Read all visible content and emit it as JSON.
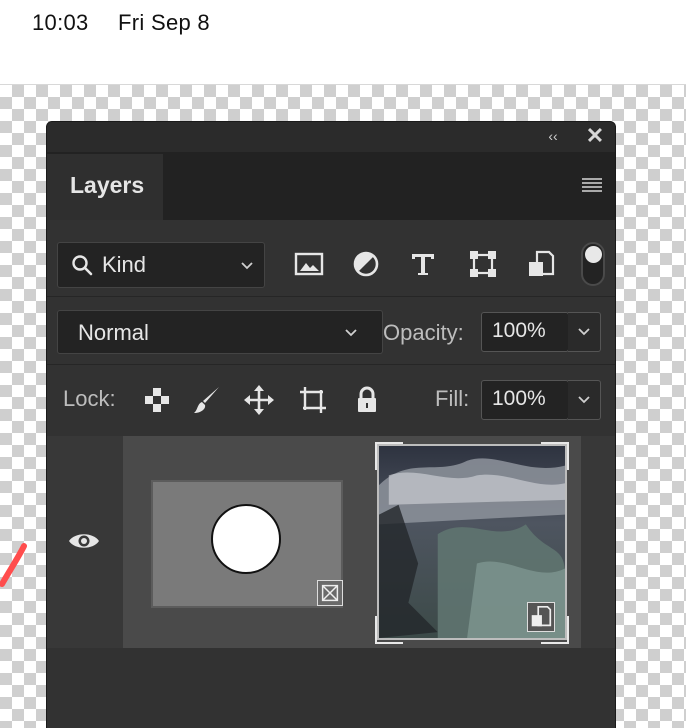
{
  "status_bar": {
    "time": "10:03",
    "date": "Fri Sep 8"
  },
  "panel": {
    "tab_title": "Layers",
    "filter": {
      "kind_label": "Kind",
      "icons": [
        "image-filter-icon",
        "adjustment-filter-icon",
        "type-filter-icon",
        "shape-filter-icon",
        "smart-object-filter-icon"
      ]
    },
    "blend_mode": "Normal",
    "opacity_label": "Opacity:",
    "opacity_value": "100%",
    "lock_label": "Lock:",
    "fill_label": "Fill:",
    "fill_value": "100%"
  },
  "colors": {
    "panel_bg": "#2b2b2b",
    "row_selected": "#4a4a4a",
    "accent_red": "#ff4d4d"
  }
}
